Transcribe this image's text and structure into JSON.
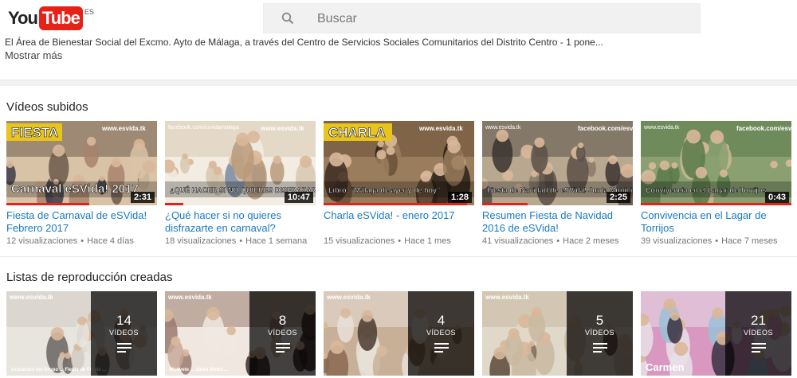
{
  "header": {
    "logo_you": "You",
    "logo_tube": "Tube",
    "logo_country": "ES",
    "search_placeholder": "Buscar"
  },
  "channel": {
    "description": "El Área de Bienestar Social del Excmo. Ayto de Málaga, a través del Centro de Servicios Sociales Comunitarios del Distrito Centro - 1 pone...",
    "show_more": "Mostrar más"
  },
  "uploads": {
    "title": "Vídeos subidos",
    "items": [
      {
        "title": "Fiesta de Carnaval de eSVida! Febrero 2017",
        "views": "12 visualizaciones",
        "age": "Hace 4 días",
        "duration": "2:31",
        "thumb_top": "FIESTA",
        "thumb_bottom": "Carnaval eSVida! 2017",
        "thumb_url": "www.esvida.tk",
        "watched": 0.55,
        "palette": [
          "#6b5a4a",
          "#a7836b",
          "#d9c3a6",
          "#3b3b48"
        ]
      },
      {
        "title": "¿Qué hacer si no quieres disfrazarte en carnaval?",
        "views": "18 visualizaciones",
        "age": "Hace 1 semana",
        "duration": "10:47",
        "thumb_top": "facebook.com/esvidamalaga",
        "thumb_bottom": "¿QUÉ HACER SI NO QUIERES DISFRAZARTE EN CARNAVAL?",
        "thumb_url": "www.esvida.tk",
        "watched": 0.12,
        "palette": [
          "#d8c8b0",
          "#b89a7a",
          "#f2ece2",
          "#7a8aa0"
        ]
      },
      {
        "title": "Charla eSVida! - enero 2017",
        "views": "15 visualizaciones",
        "age": "Hace 1 mes",
        "duration": "1:28",
        "thumb_top": "CHARLA",
        "thumb_bottom": "Libro: “Málaga de ayer y de hoy”",
        "thumb_url": "www.esvida.tk",
        "watched": 0.95,
        "palette": [
          "#6a5038",
          "#3e2c22",
          "#9a7d5c",
          "#2a2018"
        ]
      },
      {
        "title": "Resumen Fiesta de Navidad 2016 de eSVida!",
        "views": "41 visualizaciones",
        "age": "Hace 2 meses",
        "duration": "2:25",
        "thumb_top": "www.esvida.tk",
        "thumb_bottom": "Fiesta de Navidad de eSVida! Junta Municipal Distrito",
        "thumb_url": "facebook.com/esvidamalaga",
        "watched": 0.3,
        "palette": [
          "#5a5048",
          "#8a7a68",
          "#b8a890",
          "#3a3430"
        ]
      },
      {
        "title": "Convivencia en el Lagar de Torrijos",
        "views": "39 visualizaciones",
        "age": "Hace 7 meses",
        "duration": "0:43",
        "thumb_top": "www.esvida.tk",
        "thumb_bottom": "Convivencia en el Lagar de Torrijos",
        "thumb_url": "facebook.com/esvidamalaga",
        "watched": 1.0,
        "palette": [
          "#5a7a4a",
          "#c9b890",
          "#8aa070",
          "#6a4a7a"
        ]
      }
    ]
  },
  "playlists": {
    "title": "Listas de reproducción creadas",
    "items": [
      {
        "count": "14",
        "label": "VÍDEOS",
        "thumb_url": "www.esvida.tk",
        "caption": "Actuación del Grupo ... Fiesta de Fin de ...",
        "palette": [
          "#d0ccc4",
          "#a09890",
          "#e8e4de",
          "#6a6460"
        ]
      },
      {
        "count": "8",
        "label": "VÍDEOS",
        "thumb_url": "www.esvida.tk",
        "caption": "Muévete ... Junta Munic...",
        "palette": [
          "#9a7a70",
          "#c8a898",
          "#f0e8e0",
          "#3a2a28"
        ]
      },
      {
        "count": "4",
        "label": "VÍDEOS",
        "thumb_url": "www.esvida.tk",
        "caption": "",
        "palette": [
          "#e8e0d8",
          "#8a6a50",
          "#c8b098",
          "#4a3a30"
        ]
      },
      {
        "count": "5",
        "label": "VÍDEOS",
        "thumb_url": "www.esvida.tk",
        "caption": "",
        "palette": [
          "#c8b8a0",
          "#7a6a58",
          "#e0d8c8",
          "#5a4a38"
        ]
      },
      {
        "count": "21",
        "label": "VÍDEOS",
        "thumb_url": "",
        "caption": "Carmen",
        "palette": [
          "#e8e0e8",
          "#3a3040",
          "#d898c0",
          "#9ac0d8"
        ]
      }
    ]
  },
  "colors": {
    "link": "#167ac6",
    "meta": "#767676",
    "brand_red": "#e62117"
  }
}
